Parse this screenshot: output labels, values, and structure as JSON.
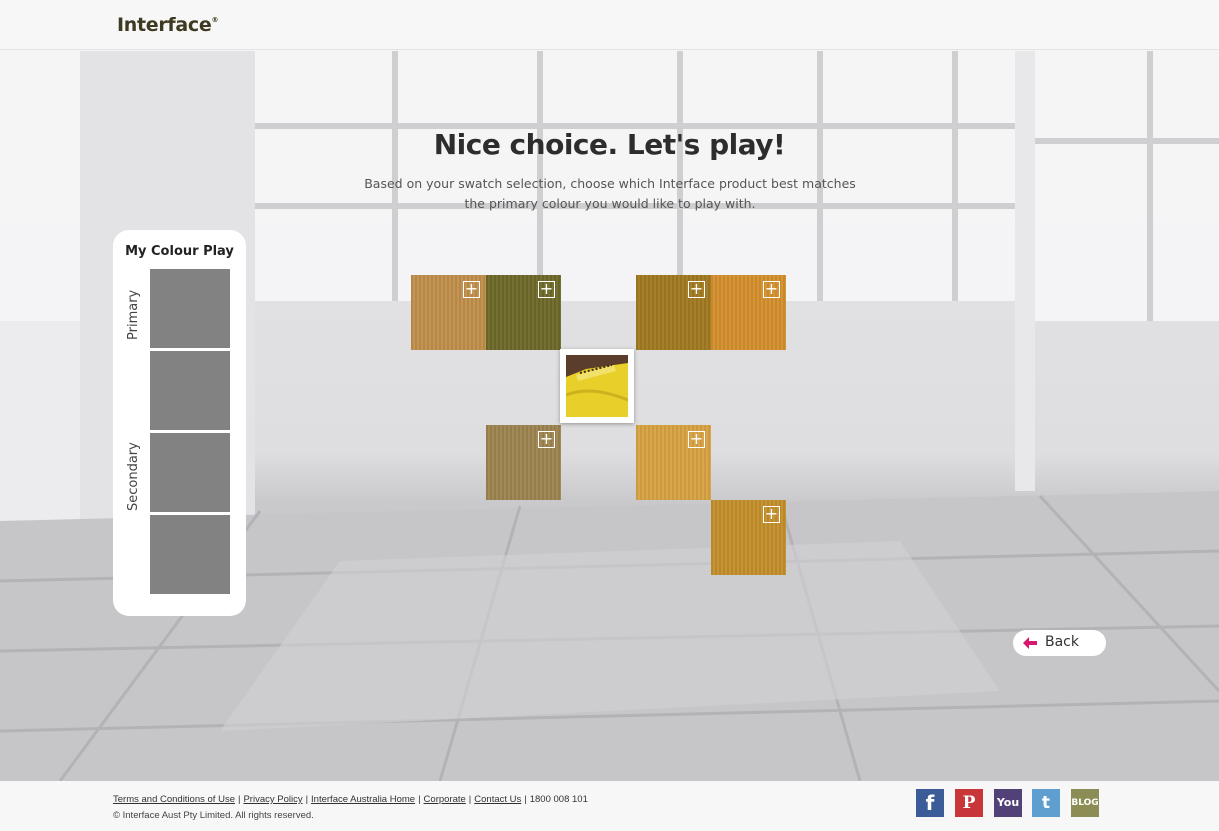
{
  "header": {
    "logo": "Interface",
    "logo_mark": "®"
  },
  "main": {
    "headline": "Nice choice. Let's play!",
    "subline": "Based on your swatch selection, choose which Interface product best matches the primary colour you would like to play with."
  },
  "panel": {
    "title": "My Colour Play",
    "primary_label": "Primary",
    "secondary_label": "Secondary"
  },
  "swatches": {
    "add_symbol": "+",
    "colors": [
      "#c1904c",
      "#6f6a2b",
      "#a27a22",
      "#d5902f",
      "#9d8550",
      "#d9a344",
      "#c4902c"
    ]
  },
  "back": {
    "label": "Back",
    "arrow_color": "#d6186f"
  },
  "footer": {
    "links": [
      "Terms and Conditions of Use",
      "Privacy Policy",
      "Interface Australia Home",
      "Corporate",
      "Contact Us"
    ],
    "phone": "1800 008 101",
    "copyright": "© Interface Aust Pty Limited. All rights reserved."
  },
  "social": {
    "facebook": "f",
    "pinterest": "P",
    "youtube": "You",
    "twitter": "t",
    "blog": "BLOG",
    "colors": {
      "facebook": "#3b5c98",
      "pinterest": "#c9363a",
      "youtube": "#514178",
      "twitter": "#5e9fd0",
      "blog": "#8b8d55"
    }
  }
}
